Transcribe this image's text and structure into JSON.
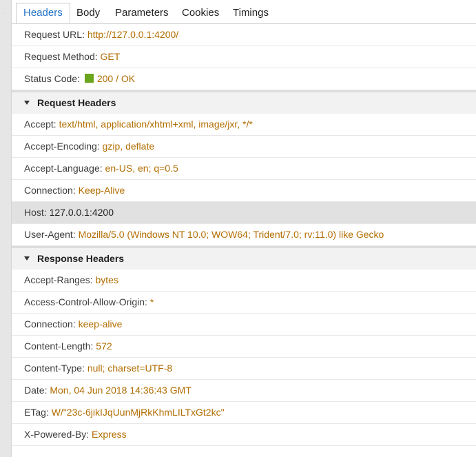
{
  "gutter": {
    "arrow": ">"
  },
  "tabs": [
    "Headers",
    "Body",
    "Parameters",
    "Cookies",
    "Timings"
  ],
  "general": {
    "url_key": "Request URL: ",
    "url_val": "http://127.0.0.1:4200/",
    "method_key": "Request Method: ",
    "method_val": "GET",
    "status_key": "Status Code: ",
    "status_val": "200 / OK",
    "status_color": "#6aa51b"
  },
  "request_headers": {
    "title": "Request Headers",
    "rows": [
      {
        "k": "Accept: ",
        "v": "text/html, application/xhtml+xml, image/jxr, */*"
      },
      {
        "k": "Accept-Encoding: ",
        "v": "gzip, deflate"
      },
      {
        "k": "Accept-Language: ",
        "v": "en-US, en; q=0.5"
      },
      {
        "k": "Connection: ",
        "v": "Keep-Alive"
      },
      {
        "k": "Host: ",
        "v": "127.0.0.1:4200",
        "selected": true
      },
      {
        "k": "User-Agent: ",
        "v": "Mozilla/5.0 (Windows NT 10.0; WOW64; Trident/7.0; rv:11.0) like Gecko"
      }
    ]
  },
  "response_headers": {
    "title": "Response Headers",
    "rows": [
      {
        "k": "Accept-Ranges: ",
        "v": "bytes"
      },
      {
        "k": "Access-Control-Allow-Origin: ",
        "v": "*"
      },
      {
        "k": "Connection: ",
        "v": "keep-alive"
      },
      {
        "k": "Content-Length: ",
        "v": "572"
      },
      {
        "k": "Content-Type: ",
        "v": "null; charset=UTF-8"
      },
      {
        "k": "Date: ",
        "v": "Mon, 04 Jun 2018 14:36:43 GMT"
      },
      {
        "k": "ETag: ",
        "v": "W/\"23c-6jikIJqUunMjRkKhmLILTxGt2kc\""
      },
      {
        "k": "X-Powered-By: ",
        "v": "Express"
      }
    ]
  }
}
